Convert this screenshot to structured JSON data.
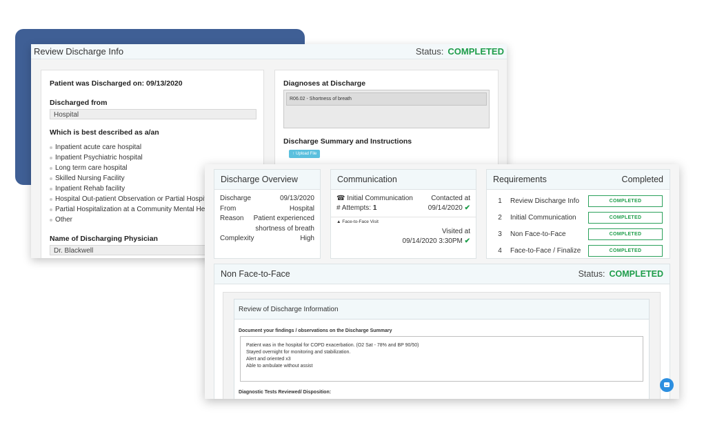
{
  "review_window": {
    "title": "Review Discharge Info",
    "status_label": "Status:",
    "status_value": "COMPLETED",
    "left": {
      "discharged_on": "Patient was Discharged on: 09/13/2020",
      "discharged_from_label": "Discharged from",
      "discharged_from_value": "Hospital",
      "best_described_label": "Which is best described as a/an",
      "options": [
        "Inpatient acute care hospital",
        "Inpatient Psychiatric hospital",
        "Long term care hospital",
        "Skilled Nursing Facility",
        "Inpatient Rehab facility",
        "Hospital Out-patient Observation or Partial Hospitalization",
        "Partial Hospitalization at a Community Mental Health Center",
        "Other"
      ],
      "physician_label": "Name of Discharging Physician",
      "physician_value": "Dr. Blackwell"
    },
    "right": {
      "diagnoses_label": "Diagnoses at Discharge",
      "diagnosis_item": "R06.02 - Shortness of breath",
      "summary_label": "Discharge Summary and Instructions",
      "upload_label": "Upload File"
    }
  },
  "front_window": {
    "overview": {
      "title": "Discharge Overview",
      "rows": [
        {
          "k": "Discharge",
          "v": "09/13/2020"
        },
        {
          "k": "From",
          "v": "Hospital"
        },
        {
          "k": "Reason",
          "v": "Patient experienced shortness of breath"
        },
        {
          "k": "Complexity",
          "v": "High"
        }
      ]
    },
    "communication": {
      "title": "Communication",
      "initial_label": "Initial Communication",
      "attempts_label": "# Attempts:",
      "attempts_value": "1",
      "contacted_label": "Contacted at",
      "contacted_date": "09/14/2020",
      "f2f_label": "Face-to-Face Visit",
      "visited_label": "Visited at",
      "visited_date": "09/14/2020 3:30PM"
    },
    "requirements": {
      "title": "Requirements",
      "status": "Completed",
      "items": [
        {
          "num": "1",
          "label": "Review Discharge Info",
          "badge": "COMPLETED"
        },
        {
          "num": "2",
          "label": "Initial Communication",
          "badge": "COMPLETED"
        },
        {
          "num": "3",
          "label": "Non Face-to-Face",
          "badge": "COMPLETED"
        },
        {
          "num": "4",
          "label": "Face-to-Face / Finalize",
          "badge": "COMPLETED"
        }
      ]
    },
    "non_f2f": {
      "title": "Non Face-to-Face",
      "status_label": "Status:",
      "status_value": "COMPLETED",
      "review_title": "Review of Discharge Information",
      "findings_label": "Document your findings / observations on the Discharge Summary",
      "findings_lines": [
        "Patient was in the hospital for COPD exacerbation. (O2 Sat - 78% and BP 90/50)",
        "Stayed overnight for monitoring and stabilization.",
        "Alert and oriented x3",
        "Able to ambulate without assist"
      ],
      "diagnostic_label": "Diagnostic Tests Reviewed/ Disposition:"
    }
  },
  "colors": {
    "accent_green": "#1e9d4a",
    "deco_blue": "#3f5f95",
    "upload_blue": "#5bc0de"
  },
  "icons": [
    "phone-icon",
    "user-icon",
    "check-icon",
    "upload-icon",
    "chat-icon"
  ]
}
